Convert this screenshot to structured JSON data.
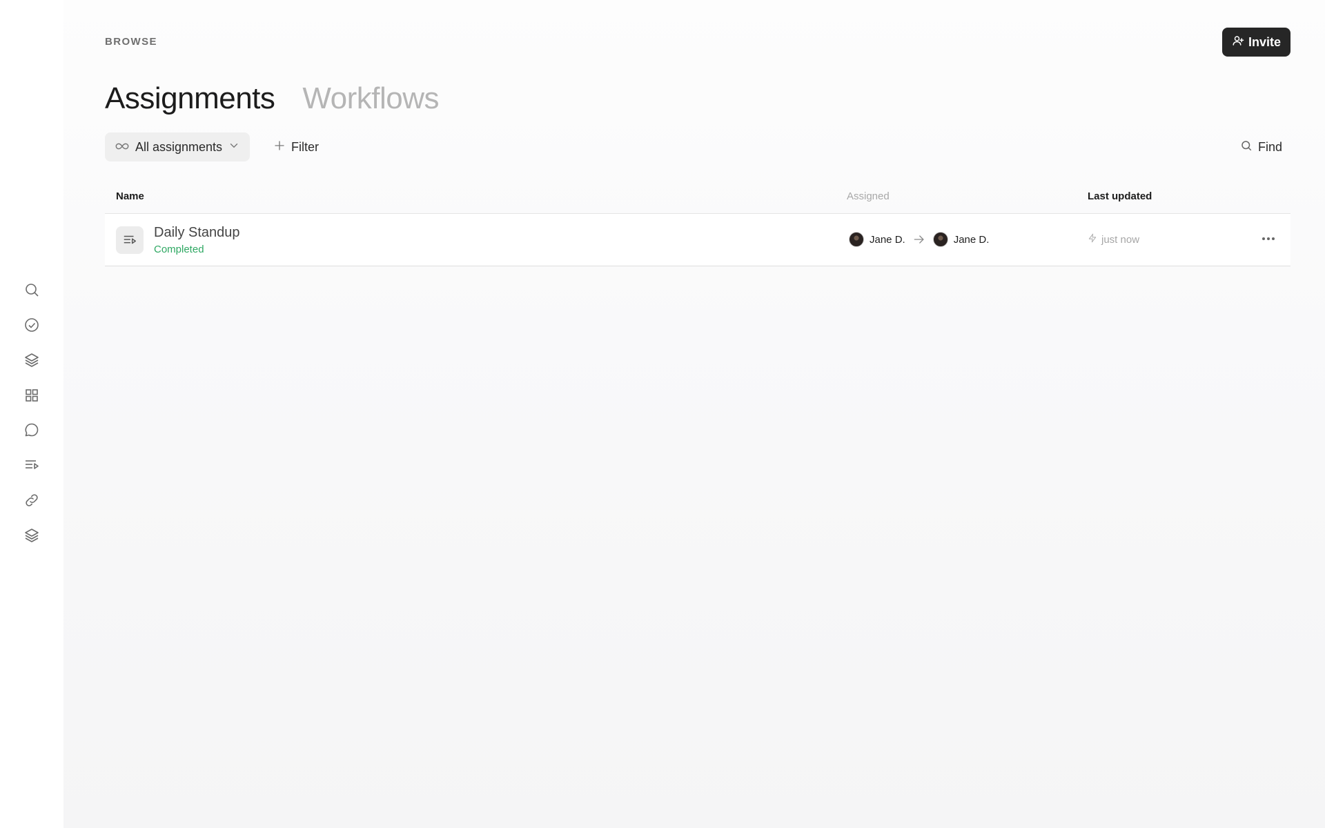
{
  "header": {
    "section_label": "BROWSE",
    "invite_label": "Invite"
  },
  "tabs": [
    {
      "label": "Assignments",
      "active": true
    },
    {
      "label": "Workflows",
      "active": false
    }
  ],
  "toolbar": {
    "view_dropdown_label": "All assignments",
    "filter_label": "Filter",
    "find_label": "Find"
  },
  "table": {
    "columns": {
      "name": "Name",
      "assigned": "Assigned",
      "last_updated": "Last updated"
    },
    "rows": [
      {
        "title": "Daily Standup",
        "status": "Completed",
        "assigned_from": "Jane D.",
        "assigned_to": "Jane D.",
        "updated": "just now"
      }
    ]
  },
  "sidebar": {
    "items": [
      {
        "icon": "search-icon"
      },
      {
        "icon": "check-circle-icon"
      },
      {
        "icon": "layers-icon"
      },
      {
        "icon": "grid-icon"
      },
      {
        "icon": "chat-bubble-icon"
      },
      {
        "icon": "playlist-icon"
      },
      {
        "icon": "link-icon"
      },
      {
        "icon": "layers-icon"
      }
    ]
  },
  "colors": {
    "accent_dark": "#262626",
    "status_completed": "#2fa863",
    "muted_text": "#a8a8a8"
  }
}
